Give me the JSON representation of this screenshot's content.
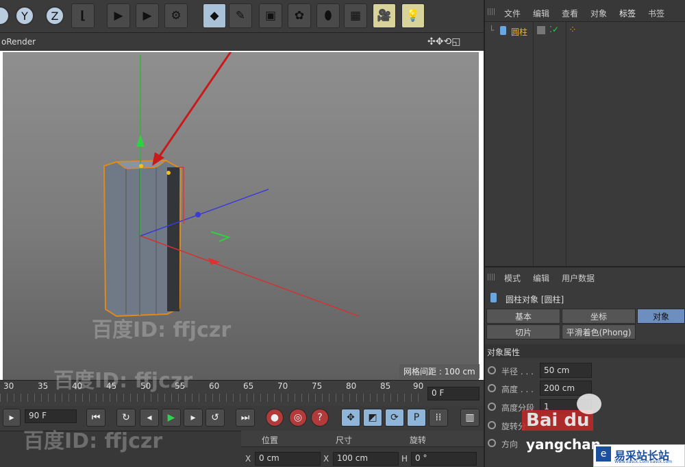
{
  "toolbar": {
    "axes": [
      "Y",
      "Z"
    ]
  },
  "viewport": {
    "title": "oRender",
    "nav_icons": "✣✥⟲◱",
    "grid_label": "网格间距 : 100 cm"
  },
  "timeline": {
    "ticks": [
      "30",
      "35",
      "40",
      "45",
      "50",
      "55",
      "60",
      "65",
      "70",
      "75",
      "80",
      "85",
      "90"
    ],
    "frame_field": "0 F",
    "end_field": "90 F"
  },
  "coords": {
    "headers": [
      "位置",
      "尺寸",
      "旋转"
    ],
    "x_label": "X",
    "x_pos": "0 cm",
    "x_size_label": "X",
    "x_size": "100 cm",
    "h_label": "H",
    "h_rot": "0 °"
  },
  "objects": {
    "menu": [
      "文件",
      "编辑",
      "查看",
      "对象",
      "标签",
      "书签"
    ],
    "item": "圆柱"
  },
  "attributes": {
    "menu": [
      "模式",
      "编辑",
      "用户数据"
    ],
    "title": "圆柱对象 [圆柱]",
    "tabs": [
      "基本",
      "坐标",
      "对象",
      "切片",
      "平滑着色(Phong)"
    ],
    "section": "对象属性",
    "props": [
      {
        "label": "半径 . . .",
        "value": "50 cm"
      },
      {
        "label": "高度 . . .",
        "value": "200 cm"
      },
      {
        "label": "高度分段",
        "value": "1"
      },
      {
        "label": "旋转分",
        "value": ""
      },
      {
        "label": "方向",
        "value": ""
      }
    ]
  },
  "watermarks": [
    "百度ID: ffjczr",
    "百度ID: ffjczr",
    "百度ID: ffjczr",
    "Bai du",
    "yangchan"
  ],
  "badge": "易采站长站",
  "badge_sub": "Www.Easck.Com  Easck.com"
}
